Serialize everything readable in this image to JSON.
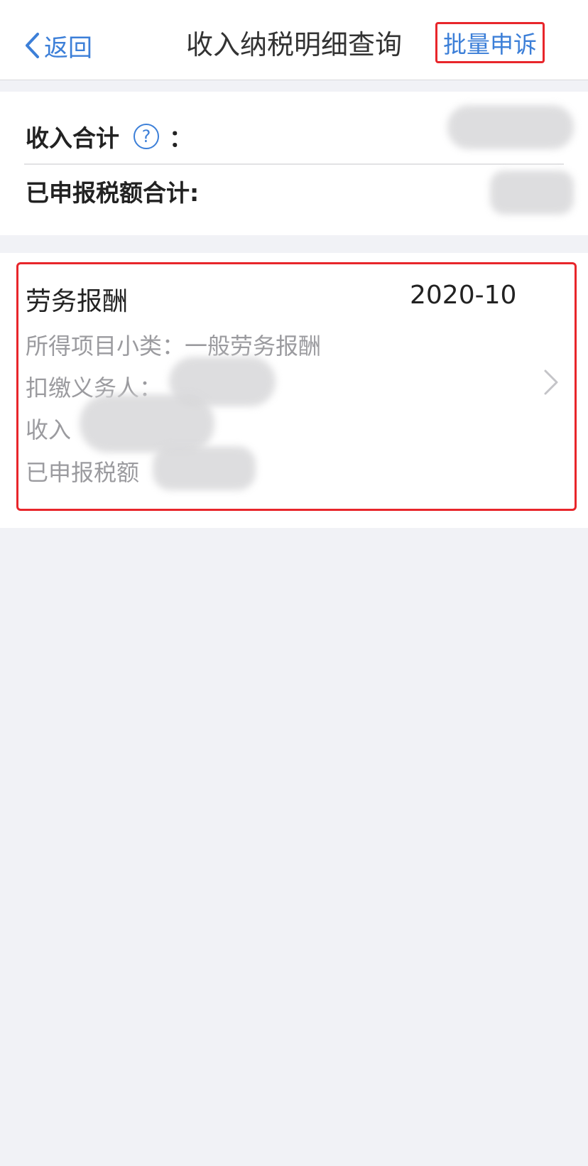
{
  "nav": {
    "back_label": "返回",
    "title": "收入纳税明细查询",
    "action_label": "批量申诉"
  },
  "summary": {
    "income_total_label": "收入合计",
    "help_symbol": "?",
    "colon": "：",
    "tax_total_label": "已申报税额合计:"
  },
  "record": {
    "category": "劳务报酬",
    "period": "2020-10",
    "subtype_label": "所得项目小类：",
    "subtype_value": "一般劳务报酬",
    "withholder_label": "扣缴义务人：",
    "income_label": "收入",
    "tax_label": "已申报税额"
  },
  "colors": {
    "accent": "#3c7fd8",
    "highlight": "#e8262b",
    "background": "#f1f2f6"
  },
  "icons": {
    "back": "chevron-left-icon",
    "help": "question-circle-icon",
    "detail": "chevron-right-icon"
  }
}
